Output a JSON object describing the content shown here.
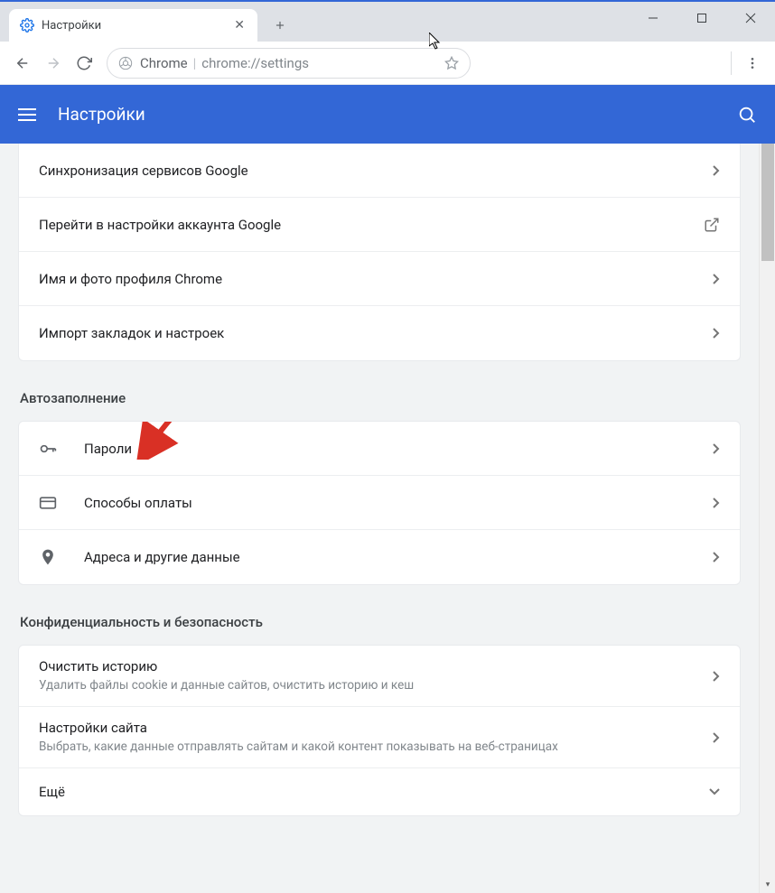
{
  "window": {
    "tab_title": "Настройки",
    "app_title": "Настройки"
  },
  "omnibox": {
    "site_label": "Chrome",
    "url": "chrome://settings"
  },
  "group1": {
    "items": [
      {
        "label": "Синхронизация сервисов Google",
        "trail": "chevron"
      },
      {
        "label": "Перейти в настройки аккаунта Google",
        "trail": "external"
      },
      {
        "label": "Имя и фото профиля Chrome",
        "trail": "chevron"
      },
      {
        "label": "Импорт закладок и настроек",
        "trail": "chevron"
      }
    ]
  },
  "autofill": {
    "title": "Автозаполнение",
    "items": [
      {
        "icon": "key",
        "label": "Пароли"
      },
      {
        "icon": "card",
        "label": "Способы оплаты"
      },
      {
        "icon": "pin",
        "label": "Адреса и другие данные"
      }
    ]
  },
  "privacy": {
    "title": "Конфиденциальность и безопасность",
    "items": [
      {
        "label": "Очистить историю",
        "sub": "Удалить файлы cookie и данные сайтов, очистить историю и кеш",
        "trail": "chevron"
      },
      {
        "label": "Настройки сайта",
        "sub": "Выбрать, какие данные отправлять сайтам и какой контент показывать на веб-страницах",
        "trail": "chevron"
      },
      {
        "label": "Ещё",
        "sub": "",
        "trail": "expand"
      }
    ]
  }
}
